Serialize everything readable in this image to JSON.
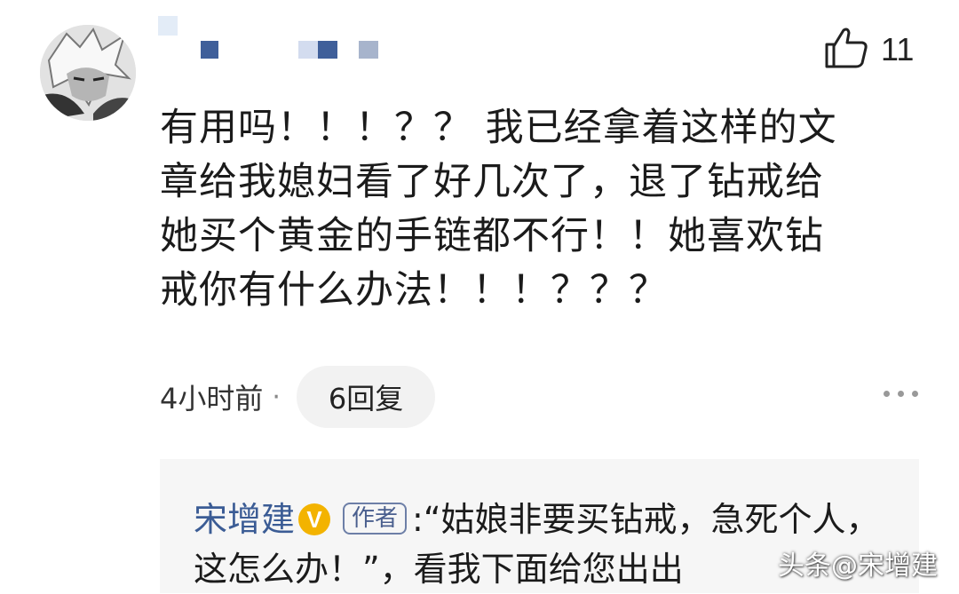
{
  "comment": {
    "like_count": "11",
    "text": "有用吗！！！？？ 我已经拿着这样的文\n章给我媳妇看了好几次了，退了钻戒给\n她买个黄金的手链都不行！！她喜欢钻\n戒你有什么办法！！！？？？",
    "time": "4小时前",
    "separator": "·",
    "reply_button": "6回复"
  },
  "reply": {
    "author_name": "宋增建",
    "verified_badge": "V",
    "author_tag": "作者",
    "colon": ":",
    "text": "“姑娘非要买钻戒，急死个人，这怎么办！”，看我下面给您出出"
  },
  "watermark": "头条@宋增建",
  "icons": {
    "like": "thumbs-up-icon",
    "more": "more-dots-icon",
    "badge": "verified-badge-icon"
  },
  "colors": {
    "author": "#3b5c95",
    "badge": "#f3b300",
    "reply_bg": "#f6f6f6",
    "button_bg": "#f2f2f2"
  }
}
